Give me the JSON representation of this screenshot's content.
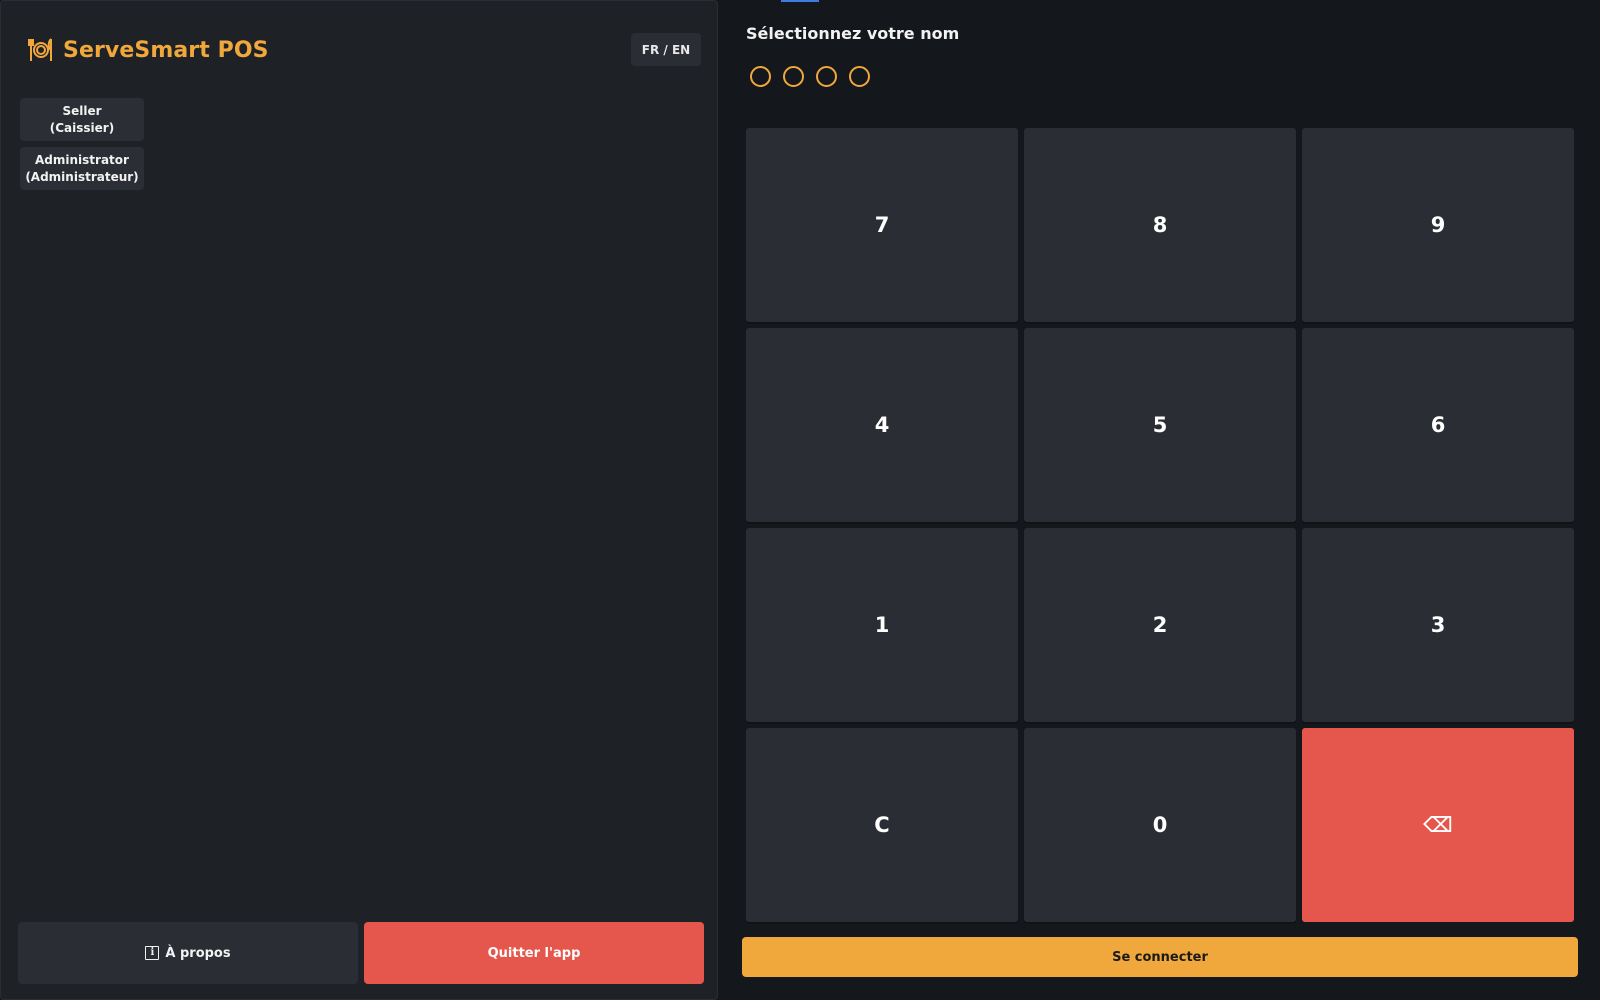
{
  "brand": {
    "name": "ServeSmart POS",
    "logo_icon": "restaurant-plate-icon",
    "accent": "#f0a73b"
  },
  "language_toggle": {
    "label": "FR / EN"
  },
  "users": [
    {
      "line1": "Seller",
      "line2": "(Caissier)"
    },
    {
      "line1": "Administrator",
      "line2": "(Administrateur)"
    }
  ],
  "footer": {
    "about_label": "À propos",
    "about_icon": "info-icon",
    "quit_label": "Quitter l'app",
    "quit_color": "#e5574c"
  },
  "login": {
    "prompt": "Sélectionnez votre nom",
    "pin_length": 4,
    "pin_filled": 0,
    "submit_label": "Se connecter"
  },
  "keypad": {
    "keys": [
      "7",
      "8",
      "9",
      "4",
      "5",
      "6",
      "1",
      "2",
      "3",
      "C",
      "0",
      "⌫"
    ],
    "backspace_color": "#e5574c"
  }
}
